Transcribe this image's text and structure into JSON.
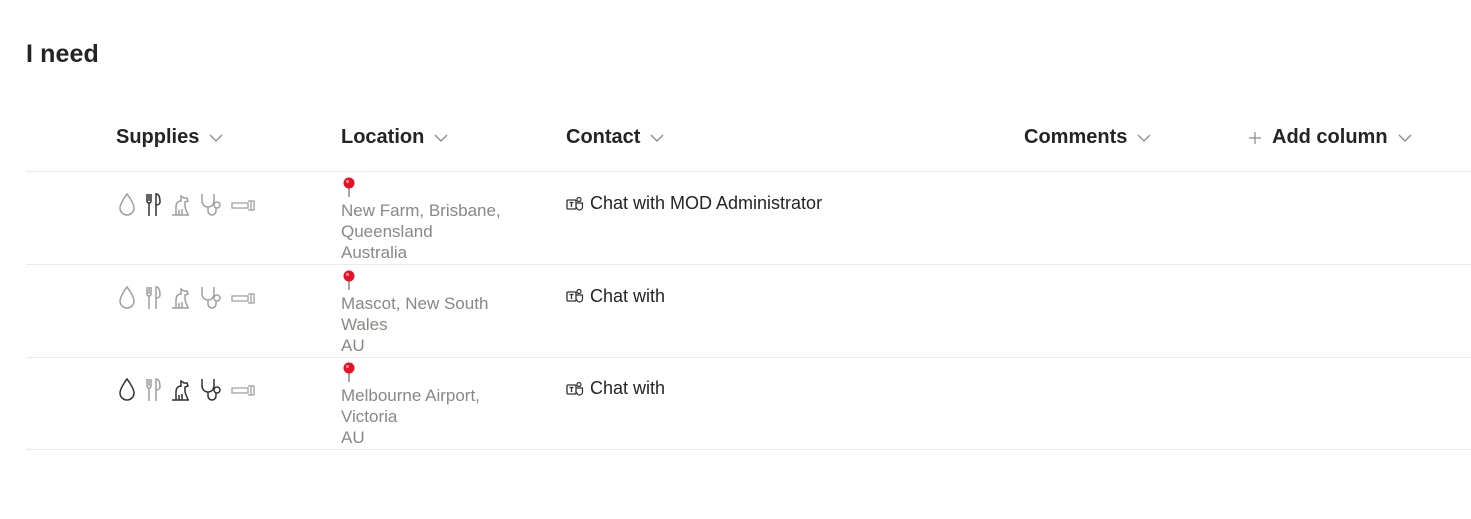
{
  "page": {
    "title": "I need"
  },
  "columns": {
    "supplies": "Supplies",
    "location": "Location",
    "contact": "Contact",
    "comments": "Comments",
    "add_column": "Add column"
  },
  "colors": {
    "active_icon": "#323130",
    "inactive_icon": "#a19f9d",
    "pin": "#e81123",
    "location_text": "#8a8886"
  },
  "supply_icons": [
    "water-drop-icon",
    "utensils-icon",
    "dog-icon",
    "stethoscope-icon",
    "flashlight-icon"
  ],
  "rows": [
    {
      "supplies_active": [
        false,
        true,
        false,
        false,
        false
      ],
      "location": {
        "line1": "New Farm, Brisbane,",
        "line2": "Queensland",
        "line3": "Australia"
      },
      "contact": "Chat with MOD Administrator",
      "comments": ""
    },
    {
      "supplies_active": [
        false,
        false,
        false,
        false,
        false
      ],
      "location": {
        "line1": "Mascot, New South",
        "line2": "Wales",
        "line3": "AU"
      },
      "contact": "Chat with",
      "comments": ""
    },
    {
      "supplies_active": [
        true,
        false,
        true,
        true,
        false
      ],
      "location": {
        "line1": "Melbourne Airport,",
        "line2": "Victoria",
        "line3": "AU"
      },
      "contact": "Chat with",
      "comments": ""
    }
  ]
}
